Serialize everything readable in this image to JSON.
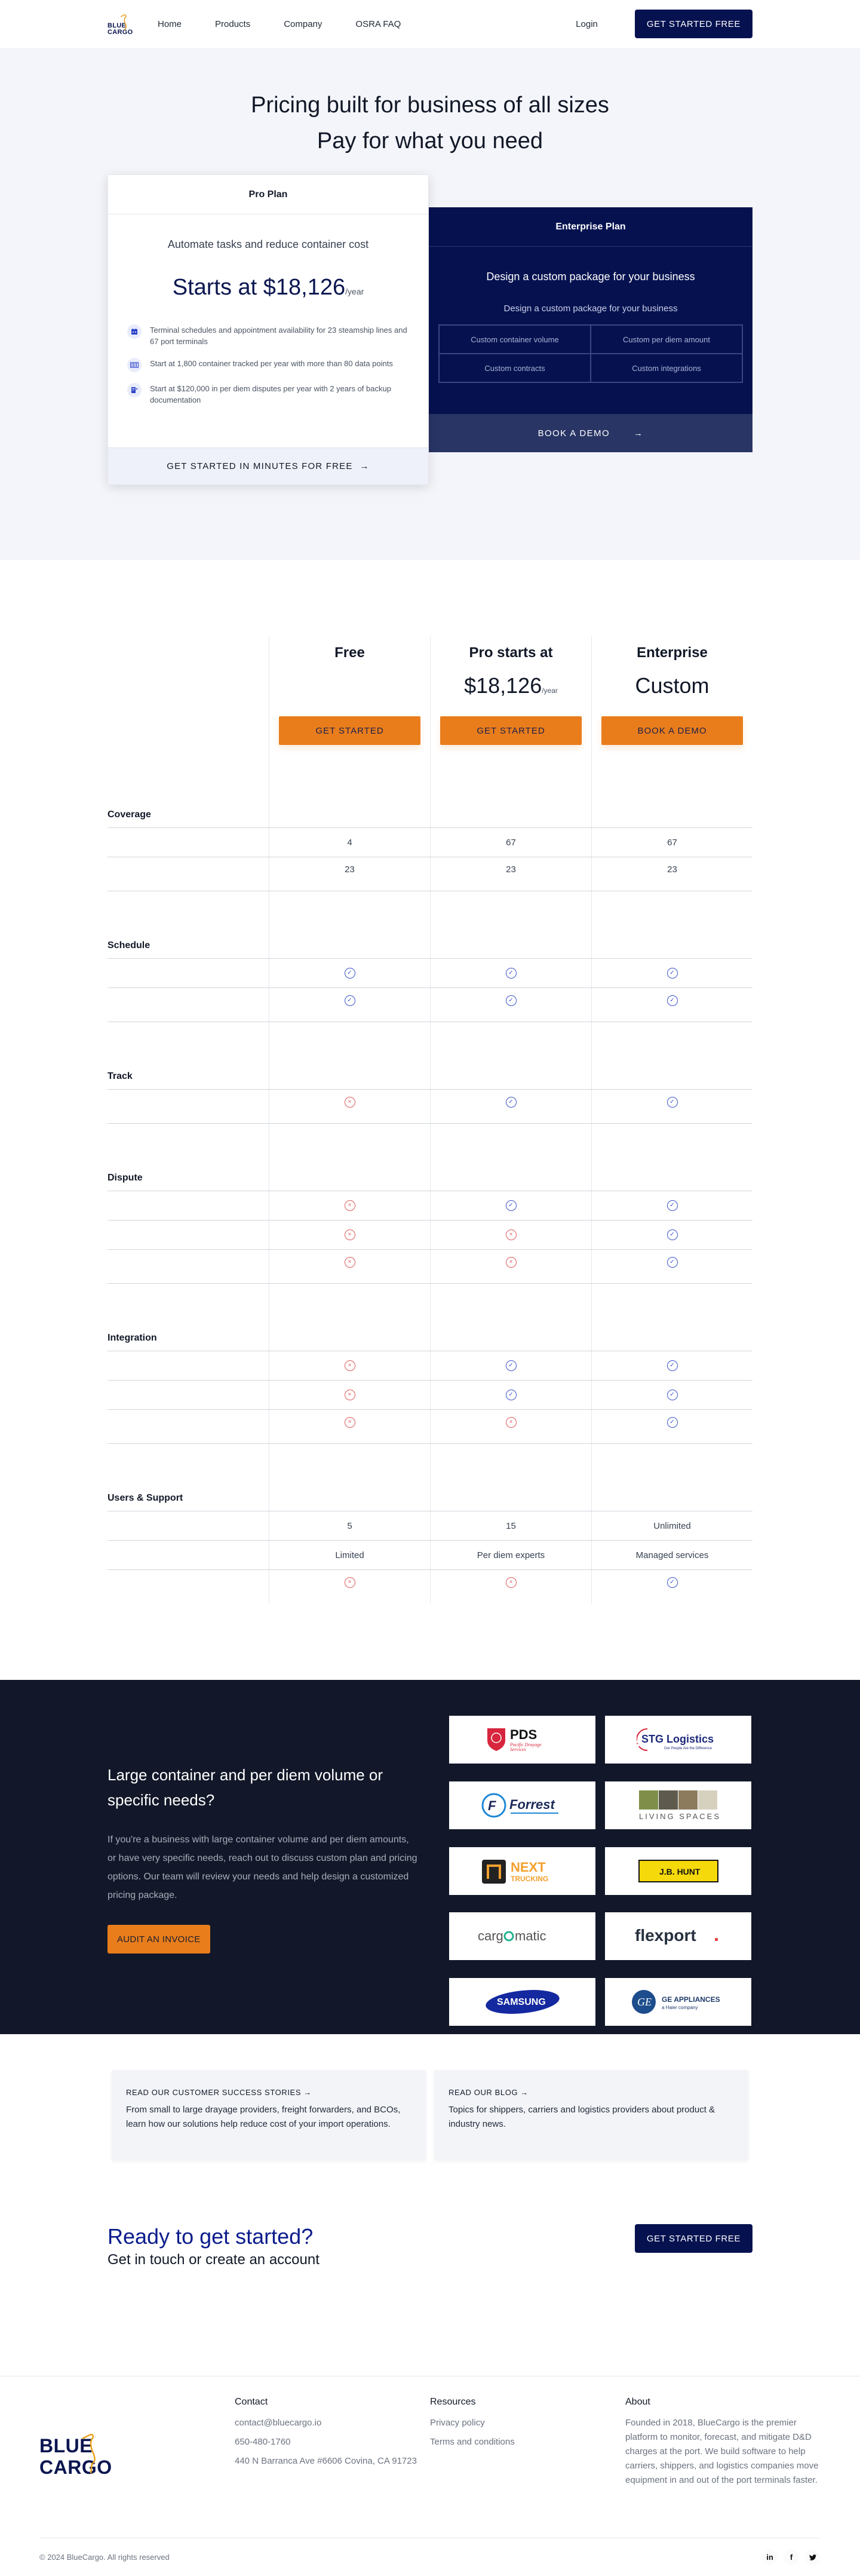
{
  "nav": {
    "logo_line1": "BLUE",
    "logo_line2": "CARGO",
    "links": [
      "Home",
      "Products",
      "Company",
      "OSRA FAQ"
    ],
    "login": "Login",
    "cta": "GET STARTED FREE"
  },
  "hero": {
    "title_line1": "Pricing built for business of all sizes",
    "title_line2": "Pay for what you need",
    "pro": {
      "title": "Pro Plan",
      "subtitle": "Automate tasks and reduce container cost",
      "price": "Starts at $18,126",
      "price_unit": "/year",
      "features": [
        {
          "icon": "calendar-icon",
          "text": "Terminal schedules and appointment availability for 23 steamship lines and 67 port terminals"
        },
        {
          "icon": "container-icon",
          "text": "Start at 1,800 container tracked per year with more than 80 data points"
        },
        {
          "icon": "document-icon",
          "text": "Start at $120,000 in per diem disputes per year with 2 years of backup documentation"
        }
      ],
      "cta": "GET STARTED IN MINUTES FOR FREE",
      "cta_arrow": "→"
    },
    "enterprise": {
      "title": "Enterprise Plan",
      "headline": "Design a custom package for your business",
      "subtitle": "Design a custom package for your business",
      "options": [
        "Custom container volume",
        "Custom per diem amount",
        "Custom contracts",
        "Custom integrations"
      ],
      "cta": "BOOK A DEMO",
      "cta_arrow": "→"
    }
  },
  "compare": {
    "columns": [
      {
        "name": "Free",
        "price": "",
        "price_unit": "",
        "button": "GET STARTED"
      },
      {
        "name": "Pro starts at",
        "price": "$18,126",
        "price_unit": "/year",
        "button": "GET STARTED"
      },
      {
        "name": "Enterprise",
        "price": "Custom",
        "price_unit": "",
        "button": "BOOK A DEMO"
      }
    ],
    "sections": [
      {
        "label": "Coverage",
        "rows": [
          [
            "4",
            "67",
            "67"
          ],
          [
            "23",
            "23",
            "23"
          ]
        ]
      },
      {
        "label": "Schedule",
        "rows": [
          [
            "yes",
            "yes",
            "yes"
          ],
          [
            "yes",
            "yes",
            "yes"
          ]
        ]
      },
      {
        "label": "Track",
        "rows": [
          [
            "no",
            "yes",
            "yes"
          ]
        ]
      },
      {
        "label": "Dispute",
        "rows": [
          [
            "no",
            "yes",
            "yes"
          ],
          [
            "no",
            "no",
            "yes"
          ],
          [
            "no",
            "no",
            "yes"
          ]
        ]
      },
      {
        "label": "Integration",
        "rows": [
          [
            "no",
            "yes",
            "yes"
          ],
          [
            "no",
            "yes",
            "yes"
          ],
          [
            "no",
            "no",
            "yes"
          ]
        ]
      },
      {
        "label": "Users & Support",
        "rows": [
          [
            "5",
            "15",
            "Unlimited"
          ],
          [
            "Limited",
            "Per diem experts",
            "Managed services"
          ],
          [
            "no",
            "no",
            "yes"
          ]
        ]
      }
    ],
    "marks": {
      "yes": "✓",
      "no": "×"
    }
  },
  "custom": {
    "title": "Large container and per diem volume or specific needs?",
    "body": "If you're a business with large container volume and per diem amounts, or have very specific needs, reach out to discuss custom plan and pricing options. Our team will review your needs and help design a customized pricing package.",
    "cta": "AUDIT AN INVOICE",
    "logos": [
      "PDS Pacific Drayage Services",
      "STG Logistics",
      "Forrest",
      "Living Spaces",
      "Next Trucking",
      "J.B. Hunt",
      "cargomatic",
      "flexport.",
      "Samsung",
      "GE Appliances"
    ]
  },
  "resources": [
    {
      "title": "READ OUR CUSTOMER SUCCESS STORIES",
      "arrow": "→",
      "desc": "From small to large drayage providers, freight forwarders, and BCOs, learn how our solutions help reduce cost of your import operations."
    },
    {
      "title": "READ OUR BLOG",
      "arrow": "→",
      "desc": "Topics for shippers, carriers and logistics providers about product & industry news."
    }
  ],
  "ready": {
    "title": "Ready to get started?",
    "subtitle": "Get in touch or create an account",
    "cta": "GET STARTED FREE"
  },
  "footer": {
    "logo_line1": "BLUE",
    "logo_line2": "CARGO",
    "contact": {
      "title": "Contact",
      "email": "contact@bluecargo.io",
      "phone": "650-480-1760",
      "address": "440 N Barranca Ave #6606 Covina, CA 91723"
    },
    "resources": {
      "title": "Resources",
      "links": [
        "Privacy policy",
        "Terms and conditions"
      ]
    },
    "about": {
      "title": "About",
      "text": "Founded in 2018, BlueCargo is the premier platform to monitor, forecast, and mitigate D&D charges at the port. We build software to help carriers, shippers, and logistics companies move equipment in and out of the port terminals faster."
    },
    "copyright": "© 2024 BlueCargo. All rights reserved",
    "socials": [
      "in",
      "f",
      "t"
    ]
  },
  "colors": {
    "navy": "#061250",
    "orange": "#e97d1c",
    "check": "#3b55c9",
    "cross": "#e05a5a",
    "dark_bg": "#121829"
  }
}
